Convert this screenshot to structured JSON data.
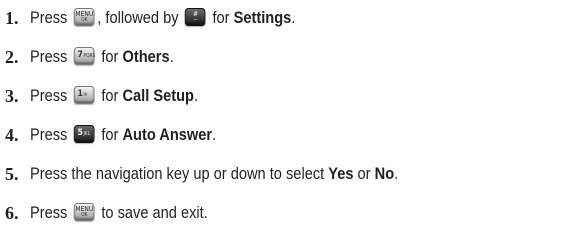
{
  "steps": [
    {
      "number": "1.",
      "press": "Press",
      "key1_top": "MENU",
      "key1_bottom": "OK",
      "followed_by": ", followed by",
      "key2_top": "#",
      "key2_bottom": "—",
      "for": "for",
      "target": "Settings",
      "end": "."
    },
    {
      "number": "2.",
      "press": "Press",
      "key_top": "7",
      "key_bottom": "PQRS",
      "for": "for",
      "target": "Others",
      "end": "."
    },
    {
      "number": "3.",
      "press": "Press",
      "key_top": "1",
      "key_bottom": "✉",
      "for": "for",
      "target": "Call Setup",
      "end": "."
    },
    {
      "number": "4.",
      "press": "Press",
      "key_top": "5",
      "key_bottom": "JKL",
      "for": "for",
      "target": "Auto Answer",
      "end": "."
    },
    {
      "number": "5.",
      "text": "Press the navigation key up or down to select",
      "opt1": "Yes",
      "or": "or",
      "opt2": "No",
      "end": "."
    },
    {
      "number": "6.",
      "press": "Press",
      "key_top": "MENU",
      "key_bottom": "OK",
      "text": "to save and exit."
    }
  ]
}
